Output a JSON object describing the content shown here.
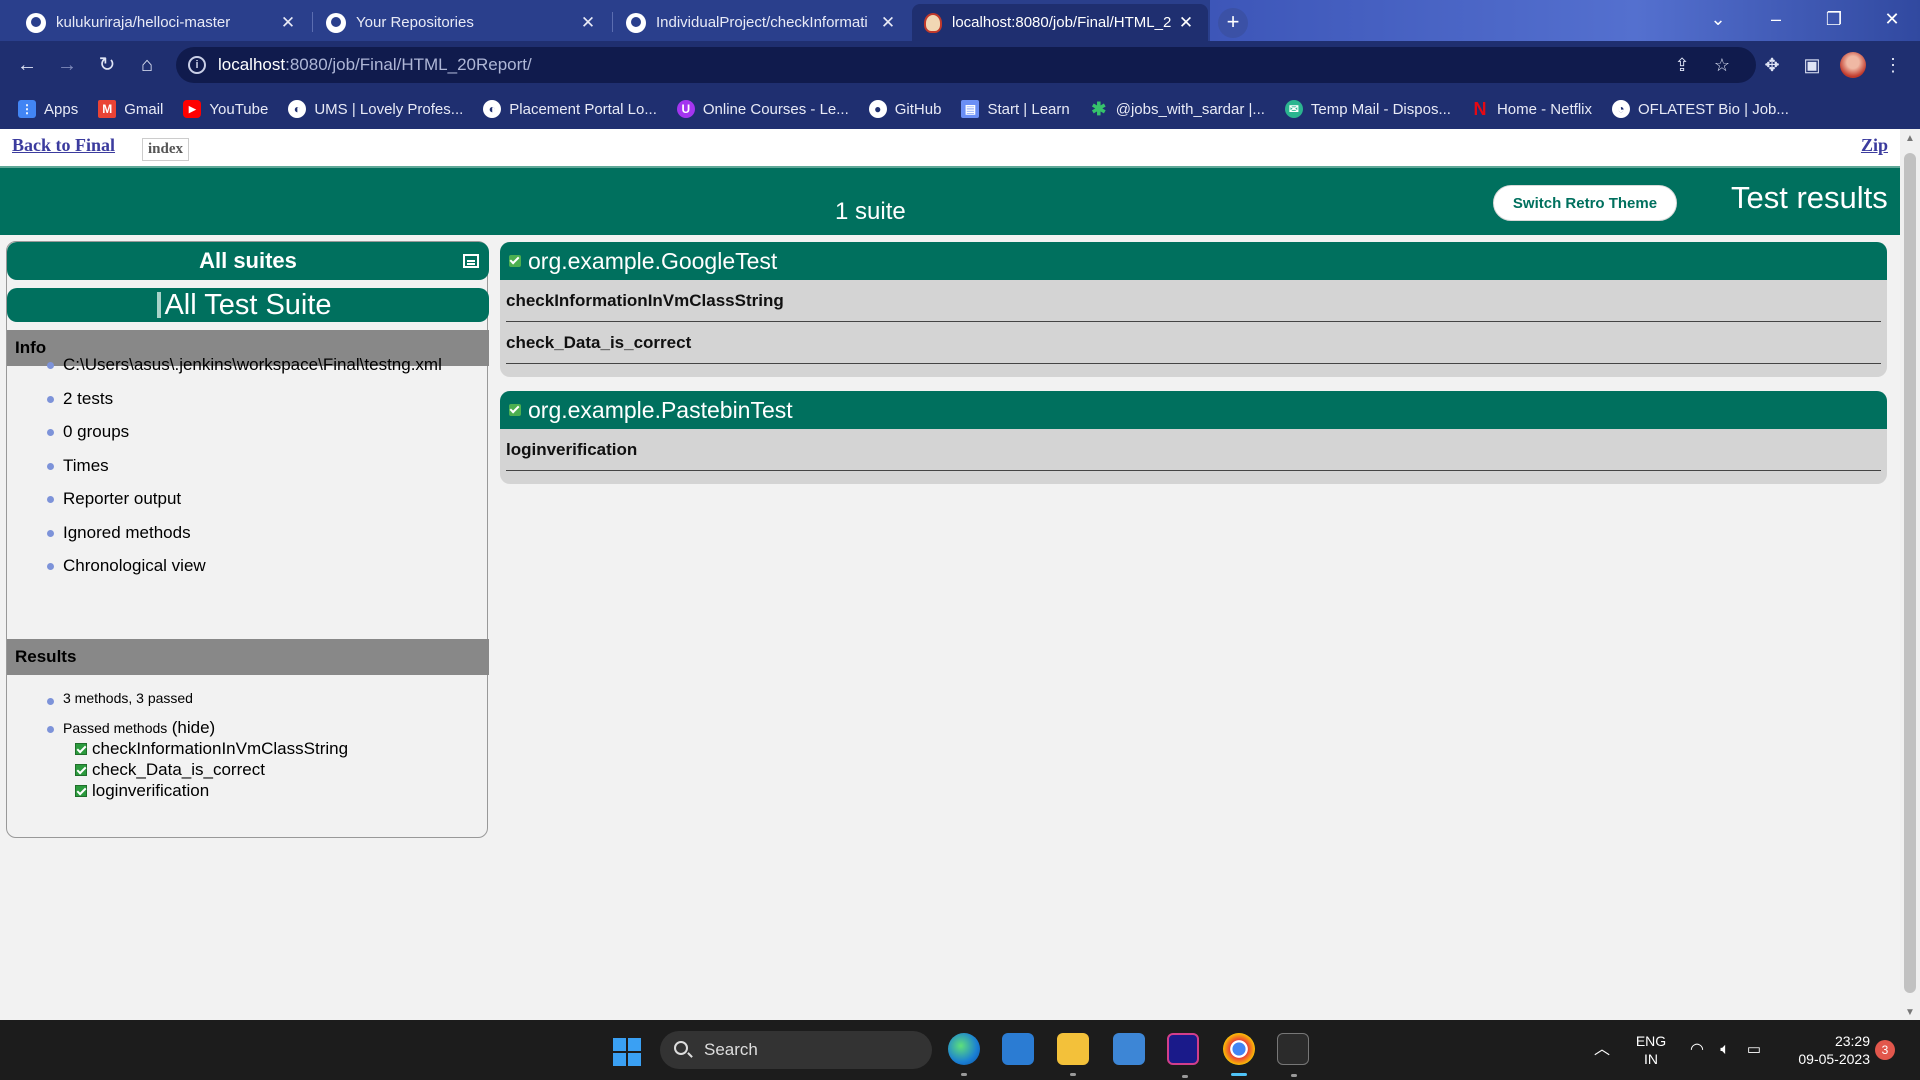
{
  "browser": {
    "tabs": [
      {
        "title": "kulukuriraja/helloci-master",
        "icon": "github-icon"
      },
      {
        "title": "Your Repositories",
        "icon": "github-icon"
      },
      {
        "title": "IndividualProject/checkInformati",
        "icon": "github-icon"
      },
      {
        "title": "localhost:8080/job/Final/HTML_2",
        "icon": "jenkins-icon"
      }
    ],
    "url_host": "localhost",
    "url_path": ":8080/job/Final/HTML_20Report/",
    "bookmarks": [
      {
        "label": "Apps",
        "icon": "apps-grid-icon",
        "color": "#4285f4"
      },
      {
        "label": "Gmail",
        "icon": "gmail-icon",
        "color": "#ea4335"
      },
      {
        "label": "YouTube",
        "icon": "youtube-icon",
        "color": "#ff0000"
      },
      {
        "label": "UMS | Lovely Profes...",
        "icon": "globe-icon",
        "color": "#ffffff"
      },
      {
        "label": "Placement Portal Lo...",
        "icon": "globe-icon",
        "color": "#ffffff"
      },
      {
        "label": "Online Courses - Le...",
        "icon": "udemy-icon",
        "color": "#a435f0"
      },
      {
        "label": "GitHub",
        "icon": "github-icon",
        "color": "#ffffff"
      },
      {
        "label": "Start | Learn",
        "icon": "learn-icon",
        "color": "#6b8ff5"
      },
      {
        "label": "@jobs_with_sardar |...",
        "icon": "asterisk-icon",
        "color": "#36c36b"
      },
      {
        "label": "Temp Mail - Dispos...",
        "icon": "tempmail-icon",
        "color": "#2bb58f"
      },
      {
        "label": "Home - Netflix",
        "icon": "netflix-icon",
        "color": "#e50914"
      },
      {
        "label": "OFLATEST Bio | Job...",
        "icon": "oflatest-icon",
        "color": "#ffffff"
      }
    ]
  },
  "report": {
    "back_link": "Back to Final",
    "index_tab": "index",
    "zip_link": "Zip",
    "suite_count": "1 suite",
    "retro_button": "Switch Retro Theme",
    "title": "Test results",
    "all_suites": "All suites",
    "suite_name": "All Test Suite",
    "info_heading": "Info",
    "info_items": [
      "C:\\Users\\asus\\.jenkins\\workspace\\Final\\testng.xml",
      "2 tests",
      "0 groups",
      "Times",
      "Reporter output",
      "Ignored methods",
      "Chronological view"
    ],
    "results_heading": "Results",
    "methods_summary": "3 methods, 3 passed",
    "passed_label": "Passed methods",
    "hide_link": "(hide)",
    "passed_methods": [
      "checkInformationInVmClassString",
      "check_Data_is_correct",
      "loginverification"
    ],
    "classes": [
      {
        "name": "org.example.GoogleTest",
        "methods": [
          "checkInformationInVmClassString",
          "check_Data_is_correct"
        ]
      },
      {
        "name": "org.example.PastebinTest",
        "methods": [
          "loginverification"
        ]
      }
    ],
    "accent_color": "#00705e"
  },
  "taskbar": {
    "search_placeholder": "Search",
    "lang_primary": "ENG",
    "lang_secondary": "IN",
    "time": "23:29",
    "date": "09-05-2023",
    "notification_count": "3"
  }
}
